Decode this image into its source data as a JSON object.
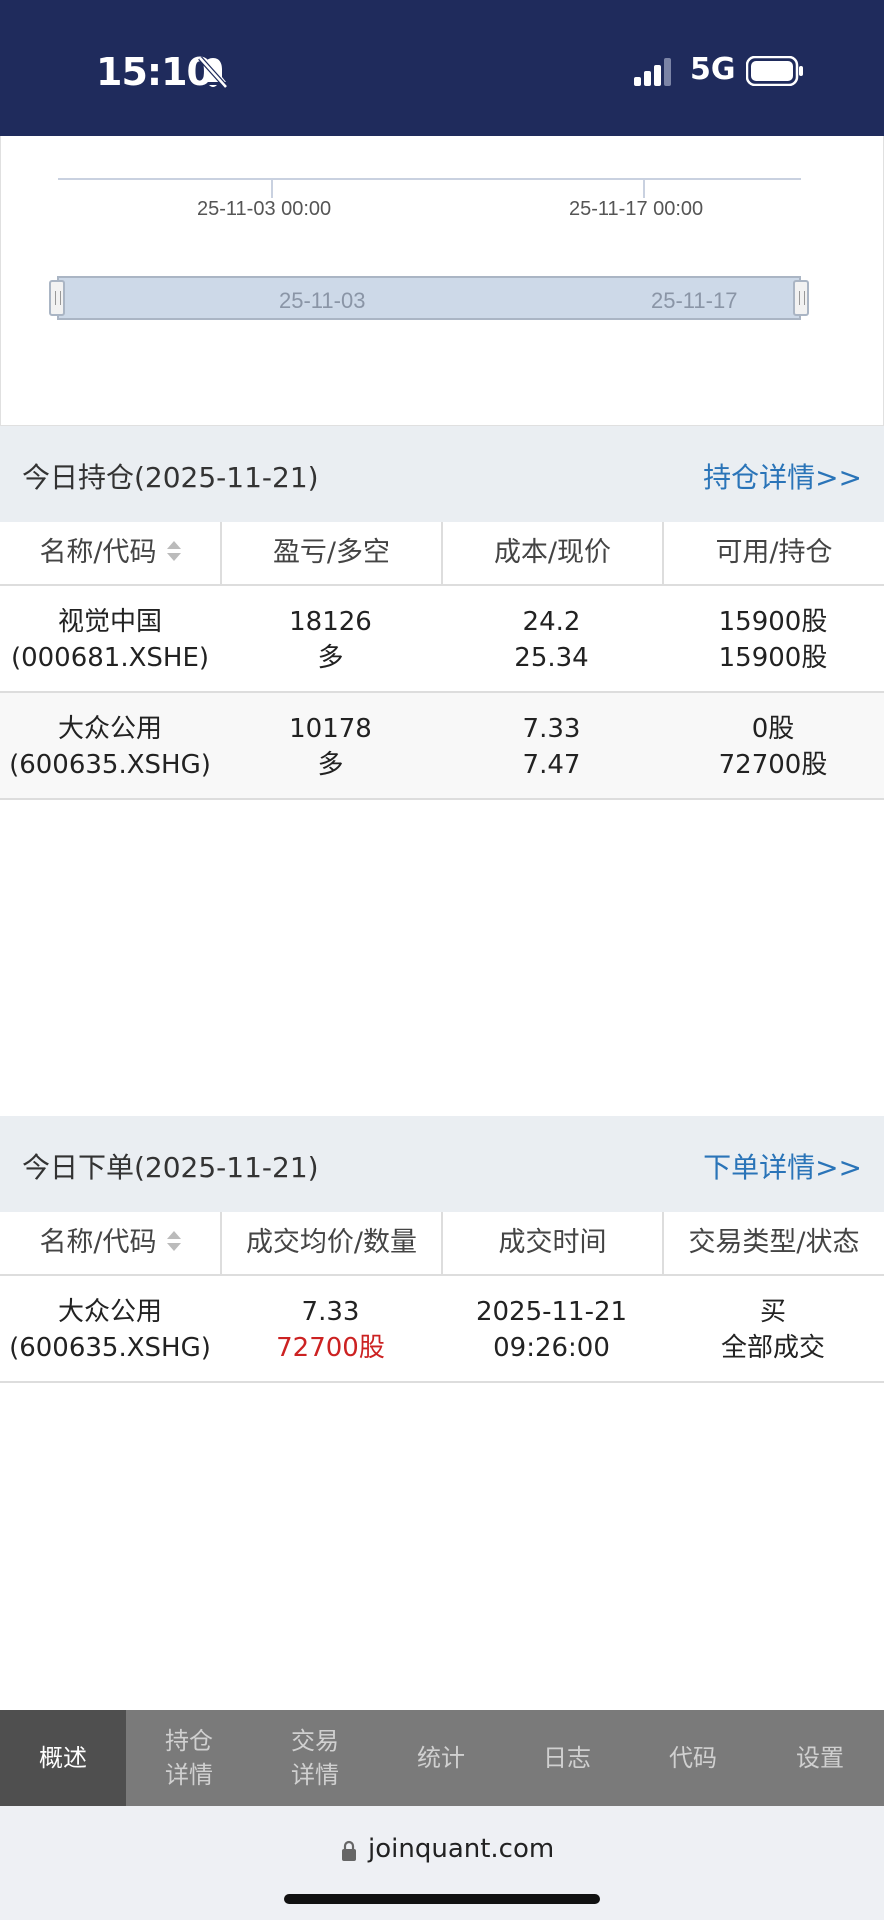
{
  "status_bar": {
    "time": "15:10",
    "network": "5G"
  },
  "chart": {
    "axis_labels": [
      "25-11-03 00:00",
      "25-11-17 00:00"
    ],
    "zoom_labels": [
      "25-11-03",
      "25-11-17"
    ]
  },
  "positions": {
    "title": "今日持仓(2025-11-21)",
    "link": "持仓详情>>",
    "headers": [
      "名称/代码",
      "盈亏/多空",
      "成本/现价",
      "可用/持仓"
    ],
    "rows": [
      {
        "name": "视觉中国",
        "code": "(000681.XSHE)",
        "pnl": "18126",
        "direction": "多",
        "cost": "24.2",
        "price": "25.34",
        "available": "15900股",
        "holding": "15900股"
      },
      {
        "name": "大众公用",
        "code": "(600635.XSHG)",
        "pnl": "10178",
        "direction": "多",
        "cost": "7.33",
        "price": "7.47",
        "available": "0股",
        "holding": "72700股"
      }
    ]
  },
  "orders": {
    "title": "今日下单(2025-11-21)",
    "link": "下单详情>>",
    "headers": [
      "名称/代码",
      "成交均价/数量",
      "成交时间",
      "交易类型/状态"
    ],
    "rows": [
      {
        "name": "大众公用",
        "code": "(600635.XSHG)",
        "avg_price": "7.33",
        "quantity": "72700股",
        "date": "2025-11-21",
        "time": "09:26:00",
        "type": "买",
        "status": "全部成交"
      }
    ]
  },
  "nav": {
    "items": [
      {
        "line1": "概述",
        "line2": ""
      },
      {
        "line1": "持仓",
        "line2": "详情"
      },
      {
        "line1": "交易",
        "line2": "详情"
      },
      {
        "line1": "统计",
        "line2": ""
      },
      {
        "line1": "日志",
        "line2": ""
      },
      {
        "line1": "代码",
        "line2": ""
      },
      {
        "line1": "设置",
        "line2": ""
      }
    ]
  },
  "browser": {
    "url": "joinquant.com"
  },
  "colors": {
    "status_bg": "#1f2b5c",
    "link": "#2a74b8",
    "highlight_red": "#cc2222",
    "nav_bg": "#7a7a7a",
    "nav_active_bg": "#4f4f4f"
  }
}
